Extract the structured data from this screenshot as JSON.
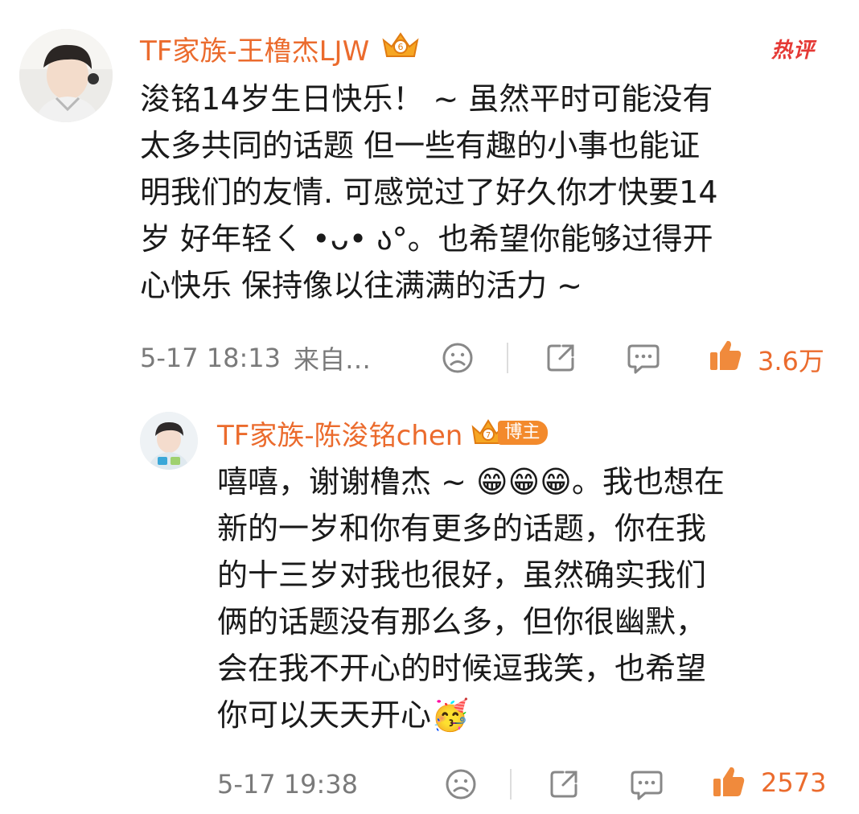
{
  "main_comment": {
    "username": "TF家族-王橹杰LJW",
    "hot_tag": "热评",
    "text_lines": [
      "浚铭14岁生日快乐！ ~  虽然平时可能没有",
      "太多共同的话题 但一些有趣的小事也能证",
      "明我们的友情. 可感觉过了好久你才快要14",
      "岁  好年轻ㄑ •ᴗ• ა°。也希望你能够过得开",
      "心快乐  保持像以往满满的活力 ~"
    ],
    "timestamp": "5-17 18:13",
    "source": "来自…",
    "like_count": "3.6万"
  },
  "reply": {
    "username": "TF家族-陈浚铭chen",
    "badge_label": "博主",
    "text_lines": [
      "嘻嘻，谢谢橹杰 ~ 😁😁😁。我也想在",
      "新的一岁和你有更多的话题，你在我",
      "的十三岁对我也很好，虽然确实我们",
      "俩的话题没有那么多，但你很幽默，",
      "会在我不开心的时候逗我笑，也希望",
      "你可以天天开心🥳"
    ],
    "timestamp": "5-17 19:38",
    "like_count": "2573"
  },
  "icons": {
    "dislike": "sad-face-icon",
    "share": "share-icon",
    "comment": "comment-icon",
    "like": "thumbs-up-icon",
    "crown": "crown-badge-icon"
  },
  "colors": {
    "username": "#eb6b2d",
    "hot_tag": "#e53935",
    "meta_gray": "#7a7a7a",
    "like_orange": "#eb6b2d"
  }
}
